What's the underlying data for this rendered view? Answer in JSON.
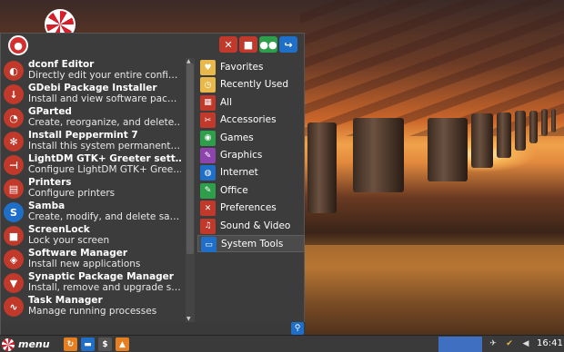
{
  "header": {
    "buttons": [
      {
        "icon": "tools-icon",
        "color": "#c0392b"
      },
      {
        "icon": "lock-icon",
        "color": "#c0392b"
      },
      {
        "icon": "users-icon",
        "color": "#2e9e4a"
      },
      {
        "icon": "logout-icon",
        "color": "#1f6fc8"
      }
    ]
  },
  "apps": [
    {
      "name": "dconf Editor",
      "desc": "Directly edit your entire confi…",
      "icon": "toggle-icon",
      "color": "#c0392b"
    },
    {
      "name": "GDebi Package Installer",
      "desc": "Install and view software pac…",
      "icon": "download-icon",
      "color": "#c0392b"
    },
    {
      "name": "GParted",
      "desc": "Create, reorganize, and delete…",
      "icon": "disk-icon",
      "color": "#c0392b"
    },
    {
      "name": "Install Peppermint 7",
      "desc": "Install this system permanent…",
      "icon": "peppermint-icon",
      "color": "#c0392b"
    },
    {
      "name": "LightDM GTK+ Greeter sett…",
      "desc": "Configure LightDM GTK+ Gree…",
      "icon": "login-icon",
      "color": "#c0392b"
    },
    {
      "name": "Printers",
      "desc": "Configure printers",
      "icon": "printer-icon",
      "color": "#c0392b"
    },
    {
      "name": "Samba",
      "desc": "Create, modify, and delete sa…",
      "icon": "samba-icon",
      "color": "#1f6fc8"
    },
    {
      "name": "ScreenLock",
      "desc": "Lock your screen",
      "icon": "lock-icon",
      "color": "#c0392b"
    },
    {
      "name": "Software Manager",
      "desc": "Install new applications",
      "icon": "software-icon",
      "color": "#c0392b"
    },
    {
      "name": "Synaptic Package Manager",
      "desc": "Install, remove and upgrade s…",
      "icon": "package-icon",
      "color": "#c0392b"
    },
    {
      "name": "Task Manager",
      "desc": "Manage running processes",
      "icon": "pulse-icon",
      "color": "#c0392b"
    }
  ],
  "categories": [
    {
      "label": "Favorites",
      "icon": "heart-icon",
      "color": "#e8b84a"
    },
    {
      "label": "Recently Used",
      "icon": "clock-icon",
      "color": "#e8b84a"
    },
    {
      "label": "All",
      "icon": "grid-icon",
      "color": "#c0392b"
    },
    {
      "label": "Accessories",
      "icon": "accessories-icon",
      "color": "#c0392b"
    },
    {
      "label": "Games",
      "icon": "gamepad-icon",
      "color": "#2e9e4a"
    },
    {
      "label": "Graphics",
      "icon": "palette-icon",
      "color": "#8e44ad"
    },
    {
      "label": "Internet",
      "icon": "globe-icon",
      "color": "#1f6fc8"
    },
    {
      "label": "Office",
      "icon": "office-icon",
      "color": "#2e9e4a"
    },
    {
      "label": "Preferences",
      "icon": "preferences-icon",
      "color": "#c0392b"
    },
    {
      "label": "Sound & Video",
      "icon": "media-icon",
      "color": "#c0392b"
    },
    {
      "label": "System Tools",
      "icon": "system-tools-icon",
      "color": "#1f6fc8"
    }
  ],
  "selected_category": "System Tools",
  "search": {
    "value": "",
    "placeholder": ""
  },
  "panel": {
    "menu_label": "menu",
    "launchers": [
      {
        "icon": "peppermint-launcher-icon",
        "color": "#e67e22"
      },
      {
        "icon": "files-icon",
        "color": "#1f6fc8"
      },
      {
        "icon": "terminal-icon",
        "color": "#555555"
      },
      {
        "icon": "vlc-icon",
        "color": "#e67e22"
      }
    ],
    "tray": [
      {
        "icon": "network-icon"
      },
      {
        "icon": "updates-icon"
      },
      {
        "icon": "volume-icon"
      }
    ],
    "clock": "16:41",
    "workspace_color": "#3f6fc0"
  }
}
